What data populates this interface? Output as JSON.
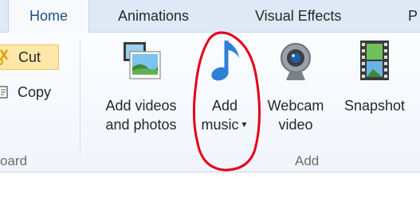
{
  "tabs": [
    {
      "label": "Home",
      "active": true
    },
    {
      "label": "Animations"
    },
    {
      "label": "Visual Effects"
    },
    {
      "label": "P"
    }
  ],
  "clipboard": {
    "cut_label": "Cut",
    "copy_label": "Copy",
    "group_label": "oard"
  },
  "add_group": {
    "add_videos": {
      "line1": "Add videos",
      "line2": "and photos",
      "icon": "film-photo-icon"
    },
    "add_music": {
      "line1": "Add",
      "line2": "music",
      "icon": "music-note-icon"
    },
    "webcam": {
      "line1": "Webcam",
      "line2": "video",
      "icon": "webcam-icon"
    },
    "snapshot": {
      "line1": "Snapshot",
      "icon": "snapshot-icon"
    },
    "group_label": "Add"
  },
  "colors": {
    "annotation_circle": "#e2001a",
    "cut_highlight": "#fde7a9",
    "note_blue": "#2f7fd6"
  }
}
